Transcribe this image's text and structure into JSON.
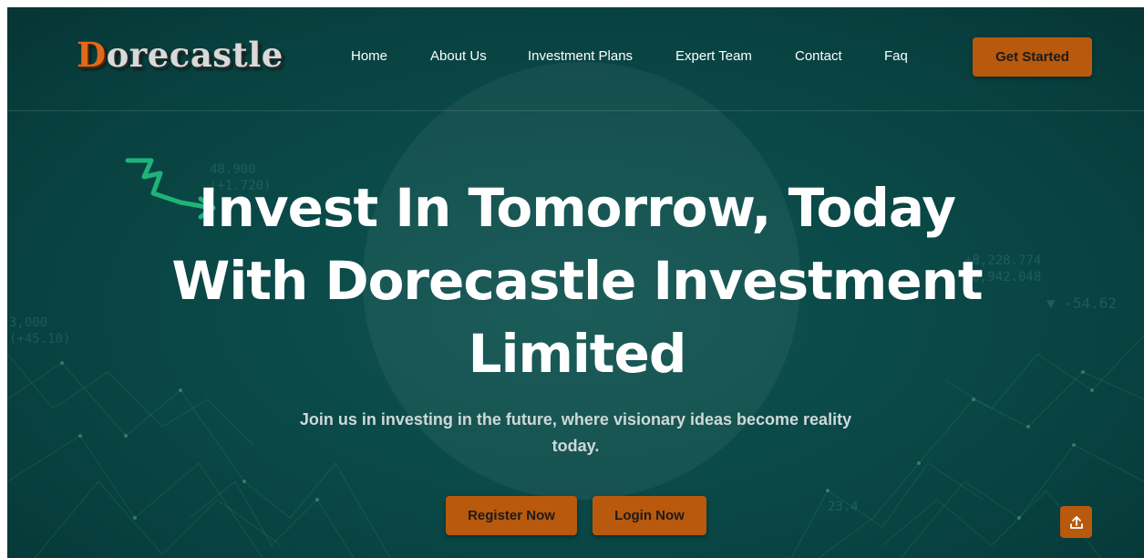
{
  "header": {
    "logo": {
      "first_letter": "D",
      "rest": "orecastle"
    },
    "nav": [
      "Home",
      "About Us",
      "Investment Plans",
      "Expert Team",
      "Contact",
      "Faq"
    ],
    "cta_label": "Get Started"
  },
  "hero": {
    "title_line1": "Invest In Tomorrow, Today",
    "title_line2": "With Dorecastle Investment",
    "title_line3": "Limited",
    "subtitle_line1": "Join us in investing in the future, where visionary ideas become reality",
    "subtitle_line2": "today.",
    "register_label": "Register Now",
    "login_label": "Login Now"
  },
  "background_tickers": [
    "48.900",
    "(+1.720)",
    "3,000",
    "(+45.10)",
    "▼ -54.62",
    "+8,228.774",
    "+8,942.048",
    "23.4"
  ],
  "colors": {
    "background": "#0a4a48",
    "accent_button": "#b8590d",
    "logo_accent": "#e06a1a",
    "arrow": "#1fb37a"
  },
  "icons": {
    "arrow": "squiggle-arrow-icon",
    "scroll_top": "upload-icon"
  }
}
